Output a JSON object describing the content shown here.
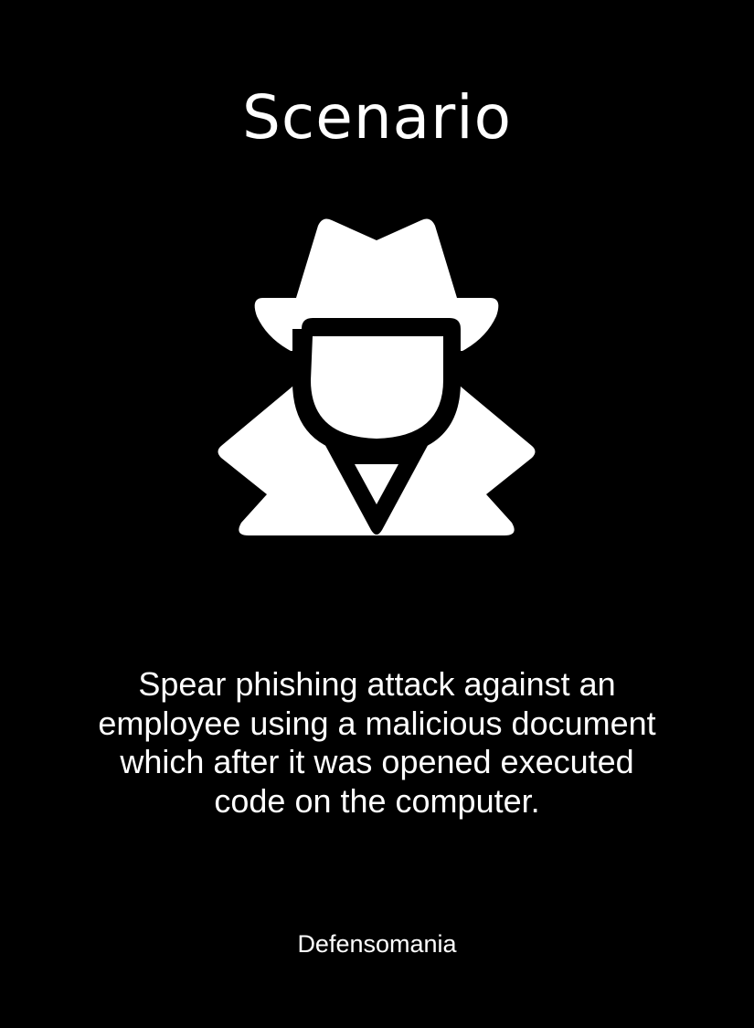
{
  "card": {
    "title": "Scenario",
    "icon": "spy-icon",
    "description": "Spear phishing attack against an employee using a malicious document which after it was opened executed code on the computer.",
    "footer": "Defensomania"
  },
  "colors": {
    "background": "#000000",
    "foreground": "#ffffff"
  }
}
